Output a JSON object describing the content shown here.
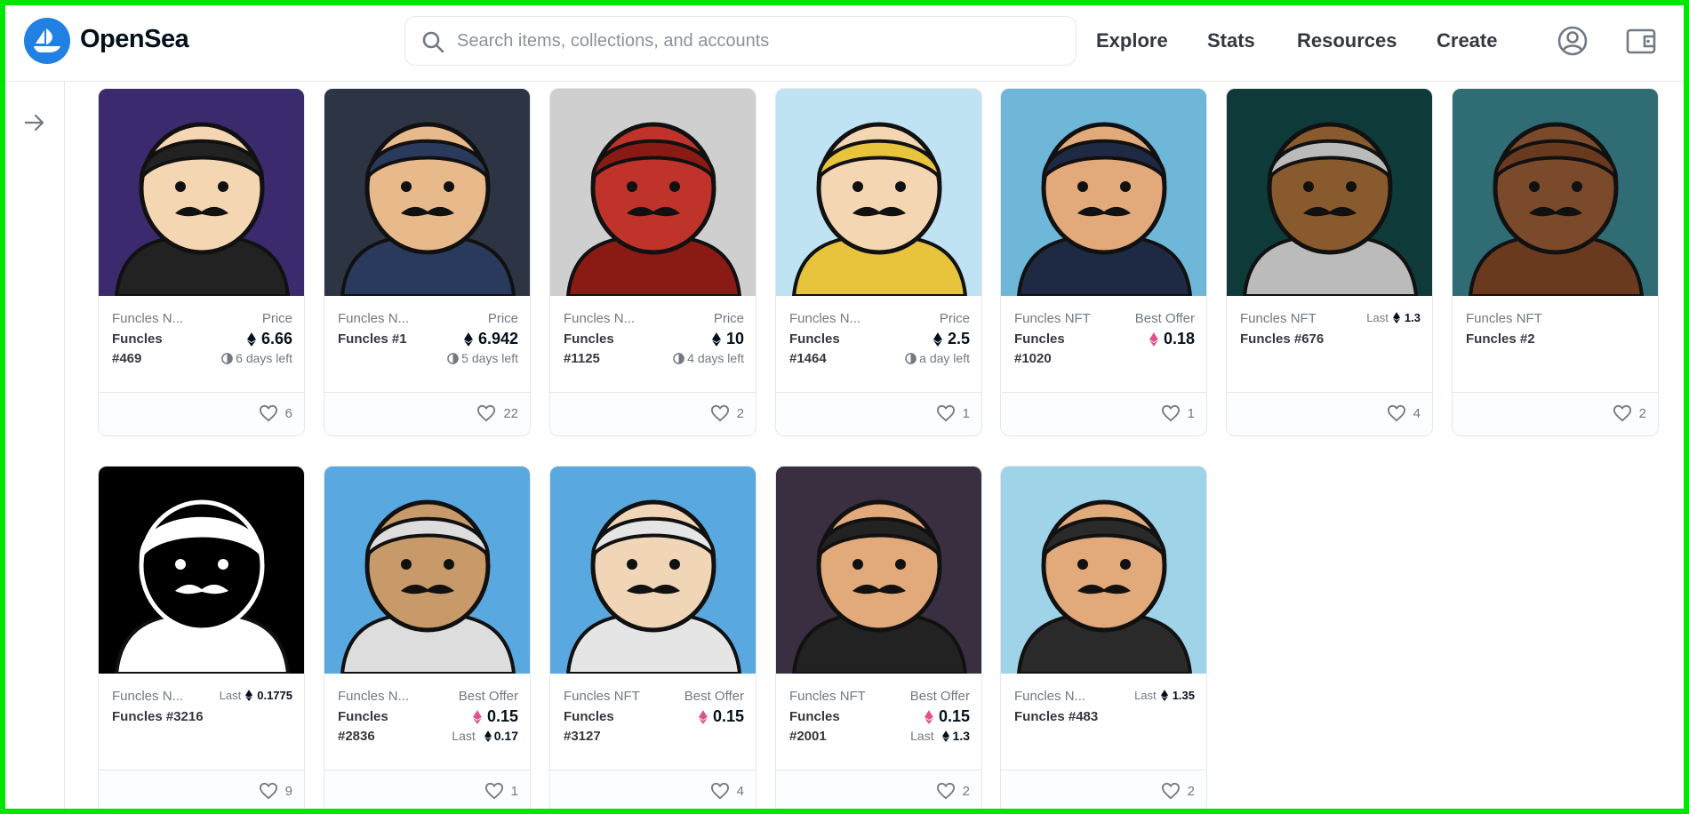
{
  "header": {
    "brand": "OpenSea",
    "search_placeholder": "Search items, collections, and accounts",
    "nav": [
      "Explore",
      "Stats",
      "Resources",
      "Create"
    ]
  },
  "colors": {
    "accent": "#2081e2",
    "offer": "#e0518f",
    "border": "#e5e8eb"
  },
  "icons": {
    "logo": "opensea-logo-icon",
    "search": "search-icon",
    "profile": "profile-icon",
    "wallet": "wallet-icon",
    "sidebar": "arrow-right-icon",
    "like": "heart-icon",
    "currency": "eth-icon"
  },
  "cards": [
    {
      "collection": "Funcles N...",
      "name": "Funcles #469",
      "price_label": "Price",
      "price": "6.66",
      "sub": "6 days left",
      "likes": "6",
      "art": {
        "bg": "#3b2a6e",
        "skin": "#f4d6b3",
        "hair": "#222"
      }
    },
    {
      "collection": "Funcles N...",
      "name": "Funcles #1",
      "price_label": "Price",
      "price": "6.942",
      "sub": "5 days left",
      "likes": "22",
      "art": {
        "bg": "#2d3545",
        "skin": "#e8b98a",
        "hair": "#2a3a5c"
      }
    },
    {
      "collection": "Funcles N...",
      "name": "Funcles #1125",
      "price_label": "Price",
      "price": "10",
      "sub": "4 days left",
      "likes": "2",
      "art": {
        "bg": "#cfcfcf",
        "skin": "#c0332b",
        "hair": "#8a1a14"
      }
    },
    {
      "collection": "Funcles N...",
      "name": "Funcles #1464",
      "price_label": "Price",
      "price": "2.5",
      "sub": "a day left",
      "likes": "1",
      "art": {
        "bg": "#bfe3f3",
        "skin": "#f4d6b3",
        "hair": "#e8c33c"
      }
    },
    {
      "collection": "Funcles NFT",
      "name": "Funcles #1020",
      "price_label": "Best Offer",
      "price": "0.18",
      "sub": "",
      "likes": "1",
      "art": {
        "bg": "#6fb7d8",
        "skin": "#e2a97a",
        "hair": "#1e2a44"
      }
    },
    {
      "collection": "Funcles NFT",
      "name": "Funcles #676",
      "price_label": "Last",
      "price": "1.3",
      "sub": "",
      "likes": "4",
      "art": {
        "bg": "#0f3a3a",
        "skin": "#8a5a2f",
        "hair": "#bbbbbb"
      }
    },
    {
      "collection": "Funcles NFT",
      "name": "Funcles #2",
      "price_label": "",
      "price": "",
      "sub": "",
      "likes": "2",
      "art": {
        "bg": "#2f6c73",
        "skin": "#7a4a2a",
        "hair": "#6a3a1f"
      }
    },
    {
      "collection": "Funcles N...",
      "name": "Funcles #3216",
      "price_label": "Last",
      "price": "0.1775",
      "sub": "",
      "likes": "9",
      "art": {
        "bg": "#000000",
        "skin": "#000000",
        "hair": "#ffffff"
      }
    },
    {
      "collection": "Funcles N...",
      "name": "Funcles #2836",
      "price_label": "Best Offer",
      "price": "0.15",
      "sub": "Last",
      "sub_val": "0.17",
      "likes": "1",
      "art": {
        "bg": "#5aa8e0",
        "skin": "#c89a6a",
        "hair": "#dddddd"
      }
    },
    {
      "collection": "Funcles NFT",
      "name": "Funcles #3127",
      "price_label": "Best Offer",
      "price": "0.15",
      "sub": "",
      "likes": "4",
      "art": {
        "bg": "#5aa8e0",
        "skin": "#f0d6b6",
        "hair": "#e5e5e5"
      }
    },
    {
      "collection": "Funcles NFT",
      "name": "Funcles #2001",
      "price_label": "Best Offer",
      "price": "0.15",
      "sub": "Last",
      "sub_val": "1.3",
      "likes": "2",
      "art": {
        "bg": "#3a2f40",
        "skin": "#e2a97a",
        "hair": "#222222"
      }
    },
    {
      "collection": "Funcles N...",
      "name": "Funcles #483",
      "price_label": "Last",
      "price": "1.35",
      "sub": "",
      "likes": "2",
      "art": {
        "bg": "#9fd3e8",
        "skin": "#e2a97a",
        "hair": "#2a2a2a"
      }
    }
  ]
}
